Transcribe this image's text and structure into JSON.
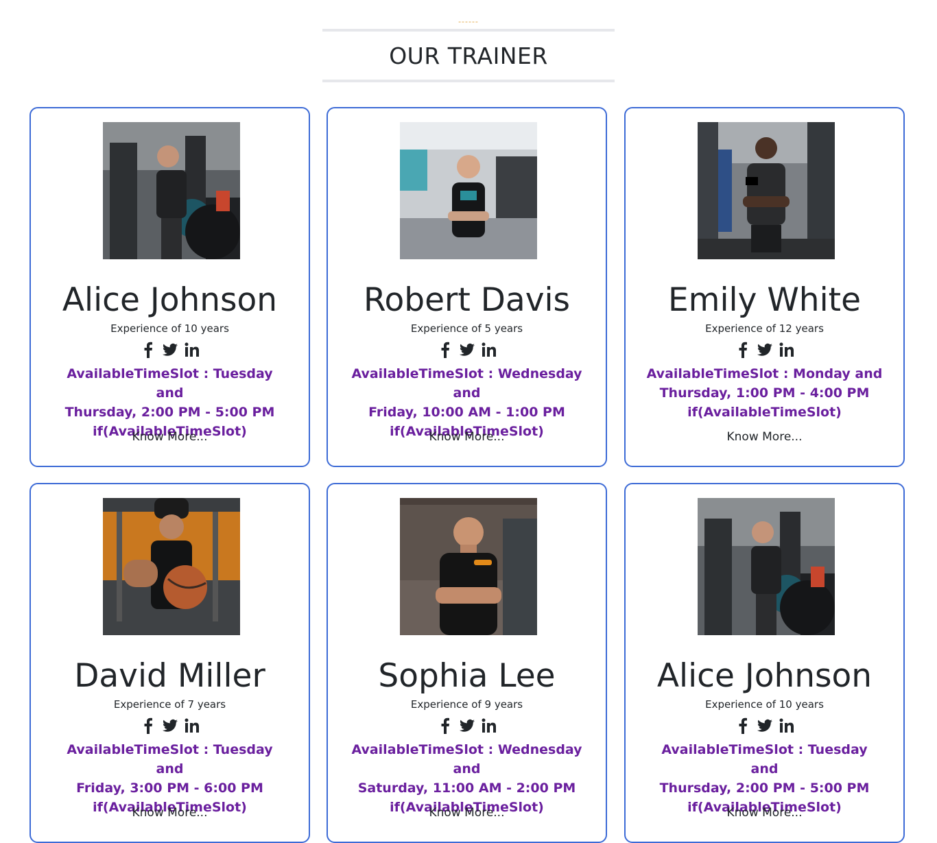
{
  "section": {
    "decoration": "------",
    "title": "OUR TRAINER"
  },
  "social_icons": [
    "facebook-icon",
    "twitter-icon",
    "linkedin-icon"
  ],
  "colors": {
    "card_border": "#3c6ad6",
    "timeslot_text": "#6a1f9e",
    "decoration": "#e2a33b",
    "title_rule": "#e6e7eb"
  },
  "trainers": [
    {
      "name": "Alice Johnson",
      "experience": "Experience of 10 years",
      "slot_line1": "AvailableTimeSlot : Tuesday and",
      "slot_line2": "Thursday, 2:00 PM - 5:00 PM",
      "slot_line3": "if(AvailableTimeSlot)",
      "more": "Know More...",
      "photo": "trainer-photo"
    },
    {
      "name": "Robert Davis",
      "experience": "Experience of 5 years",
      "slot_line1": "AvailableTimeSlot : Wednesday and",
      "slot_line2": "Friday, 10:00 AM - 1:00 PM",
      "slot_line3": "if(AvailableTimeSlot)",
      "more": "Know More...",
      "photo": "trainer-photo"
    },
    {
      "name": "Emily White",
      "experience": "Experience of 12 years",
      "slot_line1": "AvailableTimeSlot : Monday and",
      "slot_line2": "Thursday, 1:00 PM - 4:00 PM",
      "slot_line3": "if(AvailableTimeSlot)",
      "more": "Know More...",
      "photo": "trainer-photo"
    },
    {
      "name": "David Miller",
      "experience": "Experience of 7 years",
      "slot_line1": "AvailableTimeSlot : Tuesday and",
      "slot_line2": "Friday, 3:00 PM - 6:00 PM",
      "slot_line3": "if(AvailableTimeSlot)",
      "more": "Know More...",
      "photo": "trainer-photo"
    },
    {
      "name": "Sophia Lee",
      "experience": "Experience of 9 years",
      "slot_line1": "AvailableTimeSlot : Wednesday and",
      "slot_line2": "Saturday, 11:00 AM - 2:00 PM",
      "slot_line3": "if(AvailableTimeSlot)",
      "more": "Know More...",
      "photo": "trainer-photo"
    },
    {
      "name": "Alice Johnson",
      "experience": "Experience of 10 years",
      "slot_line1": "AvailableTimeSlot : Tuesday and",
      "slot_line2": "Thursday, 2:00 PM - 5:00 PM",
      "slot_line3": "if(AvailableTimeSlot)",
      "more": "Know More...",
      "photo": "trainer-photo"
    }
  ]
}
